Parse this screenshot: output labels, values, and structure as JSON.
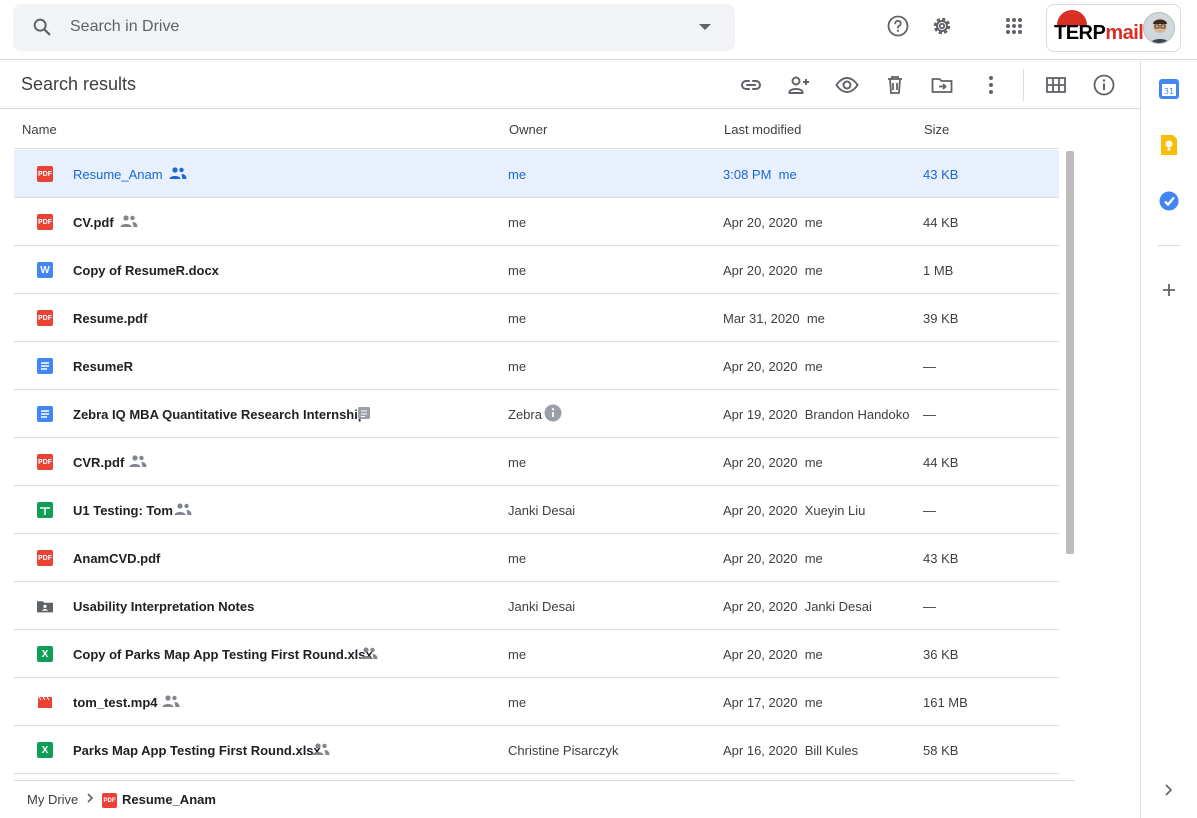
{
  "search": {
    "placeholder": "Search in Drive"
  },
  "account": {
    "logo_part1": "TERP",
    "logo_part2": "mail"
  },
  "toolbar": {
    "title": "Search results"
  },
  "columns": {
    "name": "Name",
    "owner": "Owner",
    "modified": "Last modified",
    "size": "Size"
  },
  "files": [
    {
      "name": "Resume_Anam",
      "type": "pdf",
      "shared": true,
      "owner": "me",
      "date": "3:08 PM",
      "by": "me",
      "size": "43 KB"
    },
    {
      "name": "CV.pdf",
      "type": "pdf",
      "shared": true,
      "owner": "me",
      "date": "Apr 20, 2020",
      "by": "me",
      "size": "44 KB"
    },
    {
      "name": "Copy of ResumeR.docx",
      "type": "word",
      "shared": false,
      "owner": "me",
      "date": "Apr 20, 2020",
      "by": "me",
      "size": "1 MB"
    },
    {
      "name": "Resume.pdf",
      "type": "pdf",
      "shared": false,
      "owner": "me",
      "date": "Mar 31, 2020",
      "by": "me",
      "size": "39 KB"
    },
    {
      "name": "ResumeR",
      "type": "doc",
      "shared": false,
      "owner": "me",
      "date": "Apr 20, 2020",
      "by": "me",
      "size": "—"
    },
    {
      "name": "Zebra IQ MBA Quantitative Research Internship",
      "type": "doc",
      "shared": false,
      "owner": "Zebra",
      "date": "Apr 19, 2020",
      "by": "Brandon Handoko",
      "size": "—"
    },
    {
      "name": "CVR.pdf",
      "type": "pdf",
      "shared": true,
      "owner": "me",
      "date": "Apr 20, 2020",
      "by": "me",
      "size": "44 KB"
    },
    {
      "name": "U1 Testing: Tom",
      "type": "sheet",
      "shared": true,
      "owner": "Janki Desai",
      "date": "Apr 20, 2020",
      "by": "Xueyin Liu",
      "size": "—"
    },
    {
      "name": "AnamCVD.pdf",
      "type": "pdf",
      "shared": false,
      "owner": "me",
      "date": "Apr 20, 2020",
      "by": "me",
      "size": "43 KB"
    },
    {
      "name": "Usability Interpretation Notes",
      "type": "folder",
      "shared": false,
      "owner": "Janki Desai",
      "date": "Apr 20, 2020",
      "by": "Janki Desai",
      "size": "—"
    },
    {
      "name": "Copy of Parks Map App Testing First Round.xlsx",
      "type": "excel",
      "shared": true,
      "owner": "me",
      "date": "Apr 20, 2020",
      "by": "me",
      "size": "36 KB"
    },
    {
      "name": "tom_test.mp4",
      "type": "video",
      "shared": true,
      "owner": "me",
      "date": "Apr 17, 2020",
      "by": "me",
      "size": "161 MB"
    },
    {
      "name": "Parks Map App Testing First Round.xlsx",
      "type": "excel",
      "shared": true,
      "owner": "Christine Pisarczyk",
      "date": "Apr 16, 2020",
      "by": "Bill Kules",
      "size": "58 KB"
    }
  ],
  "breadcrumb": {
    "root": "My Drive",
    "current": "Resume_Anam"
  },
  "icon_labels": {
    "pdf": "PDF",
    "word": "W",
    "excel": "X"
  },
  "colors": {
    "pdf": "#ea4335",
    "doc": "#4285f4",
    "word": "#4285f4",
    "sheet": "#0f9d58",
    "excel": "#0f9d58",
    "video": "#ea4335",
    "folder": "#5f6368",
    "selected_bg": "#e8f0fe",
    "accent": "#1967d2"
  }
}
